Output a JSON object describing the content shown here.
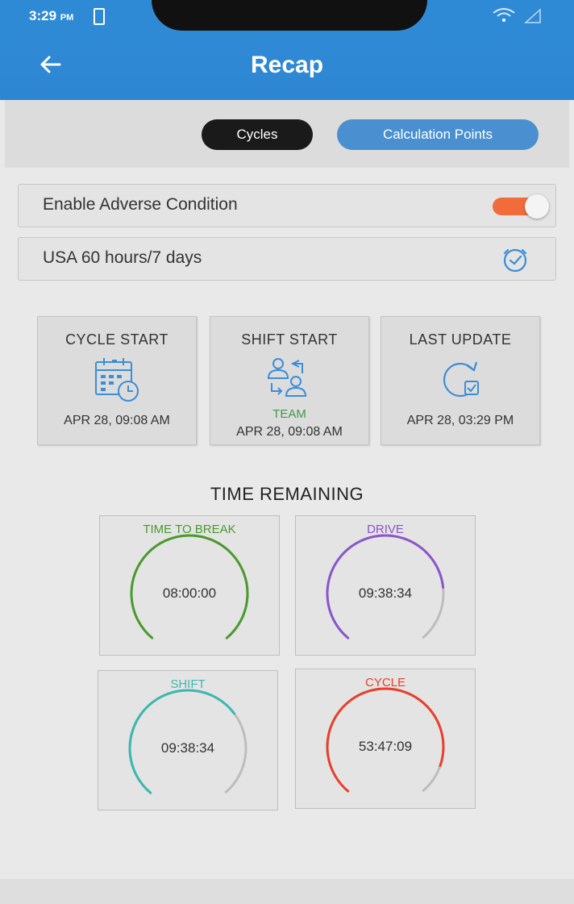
{
  "status": {
    "time": "3:29",
    "ampm": "PM"
  },
  "header": {
    "title": "Recap",
    "back_icon": "arrow-left-icon"
  },
  "tabs": [
    {
      "label": "Cycles",
      "active": true
    },
    {
      "label": "Calculation Points",
      "active": false
    }
  ],
  "settings": {
    "adverse_label": "Enable Adverse Condition",
    "adverse_enabled": true,
    "ruleset_label": "USA 60 hours/7 days"
  },
  "cards": {
    "cycle_start": {
      "title": "CYCLE START",
      "value": "APR 28, 09:08 AM",
      "icon": "calendar-clock-icon"
    },
    "shift_start": {
      "title": "SHIFT START",
      "tag": "TEAM",
      "value": "APR 28, 09:08 AM",
      "icon": "team-swap-icon"
    },
    "last_update": {
      "title": "LAST UPDATE",
      "value": "APR 28, 03:29 PM",
      "icon": "refresh-check-icon"
    }
  },
  "time_remaining": {
    "heading": "TIME REMAINING",
    "gauges": [
      {
        "label": "TIME TO BREAK",
        "value": "08:00:00",
        "color": "#4a9a2c",
        "fraction": 1.0
      },
      {
        "label": "DRIVE",
        "value": "09:38:34",
        "color": "#8b55cc",
        "fraction": 0.8
      },
      {
        "label": "SHIFT",
        "value": "09:38:34",
        "color": "#3ab8b0",
        "fraction": 0.69
      },
      {
        "label": "CYCLE",
        "value": "53:47:09",
        "color": "#e8402a",
        "fraction": 0.89
      }
    ]
  },
  "colors": {
    "primary": "#2f8ad6",
    "toggle_on": "#f26b3a"
  }
}
